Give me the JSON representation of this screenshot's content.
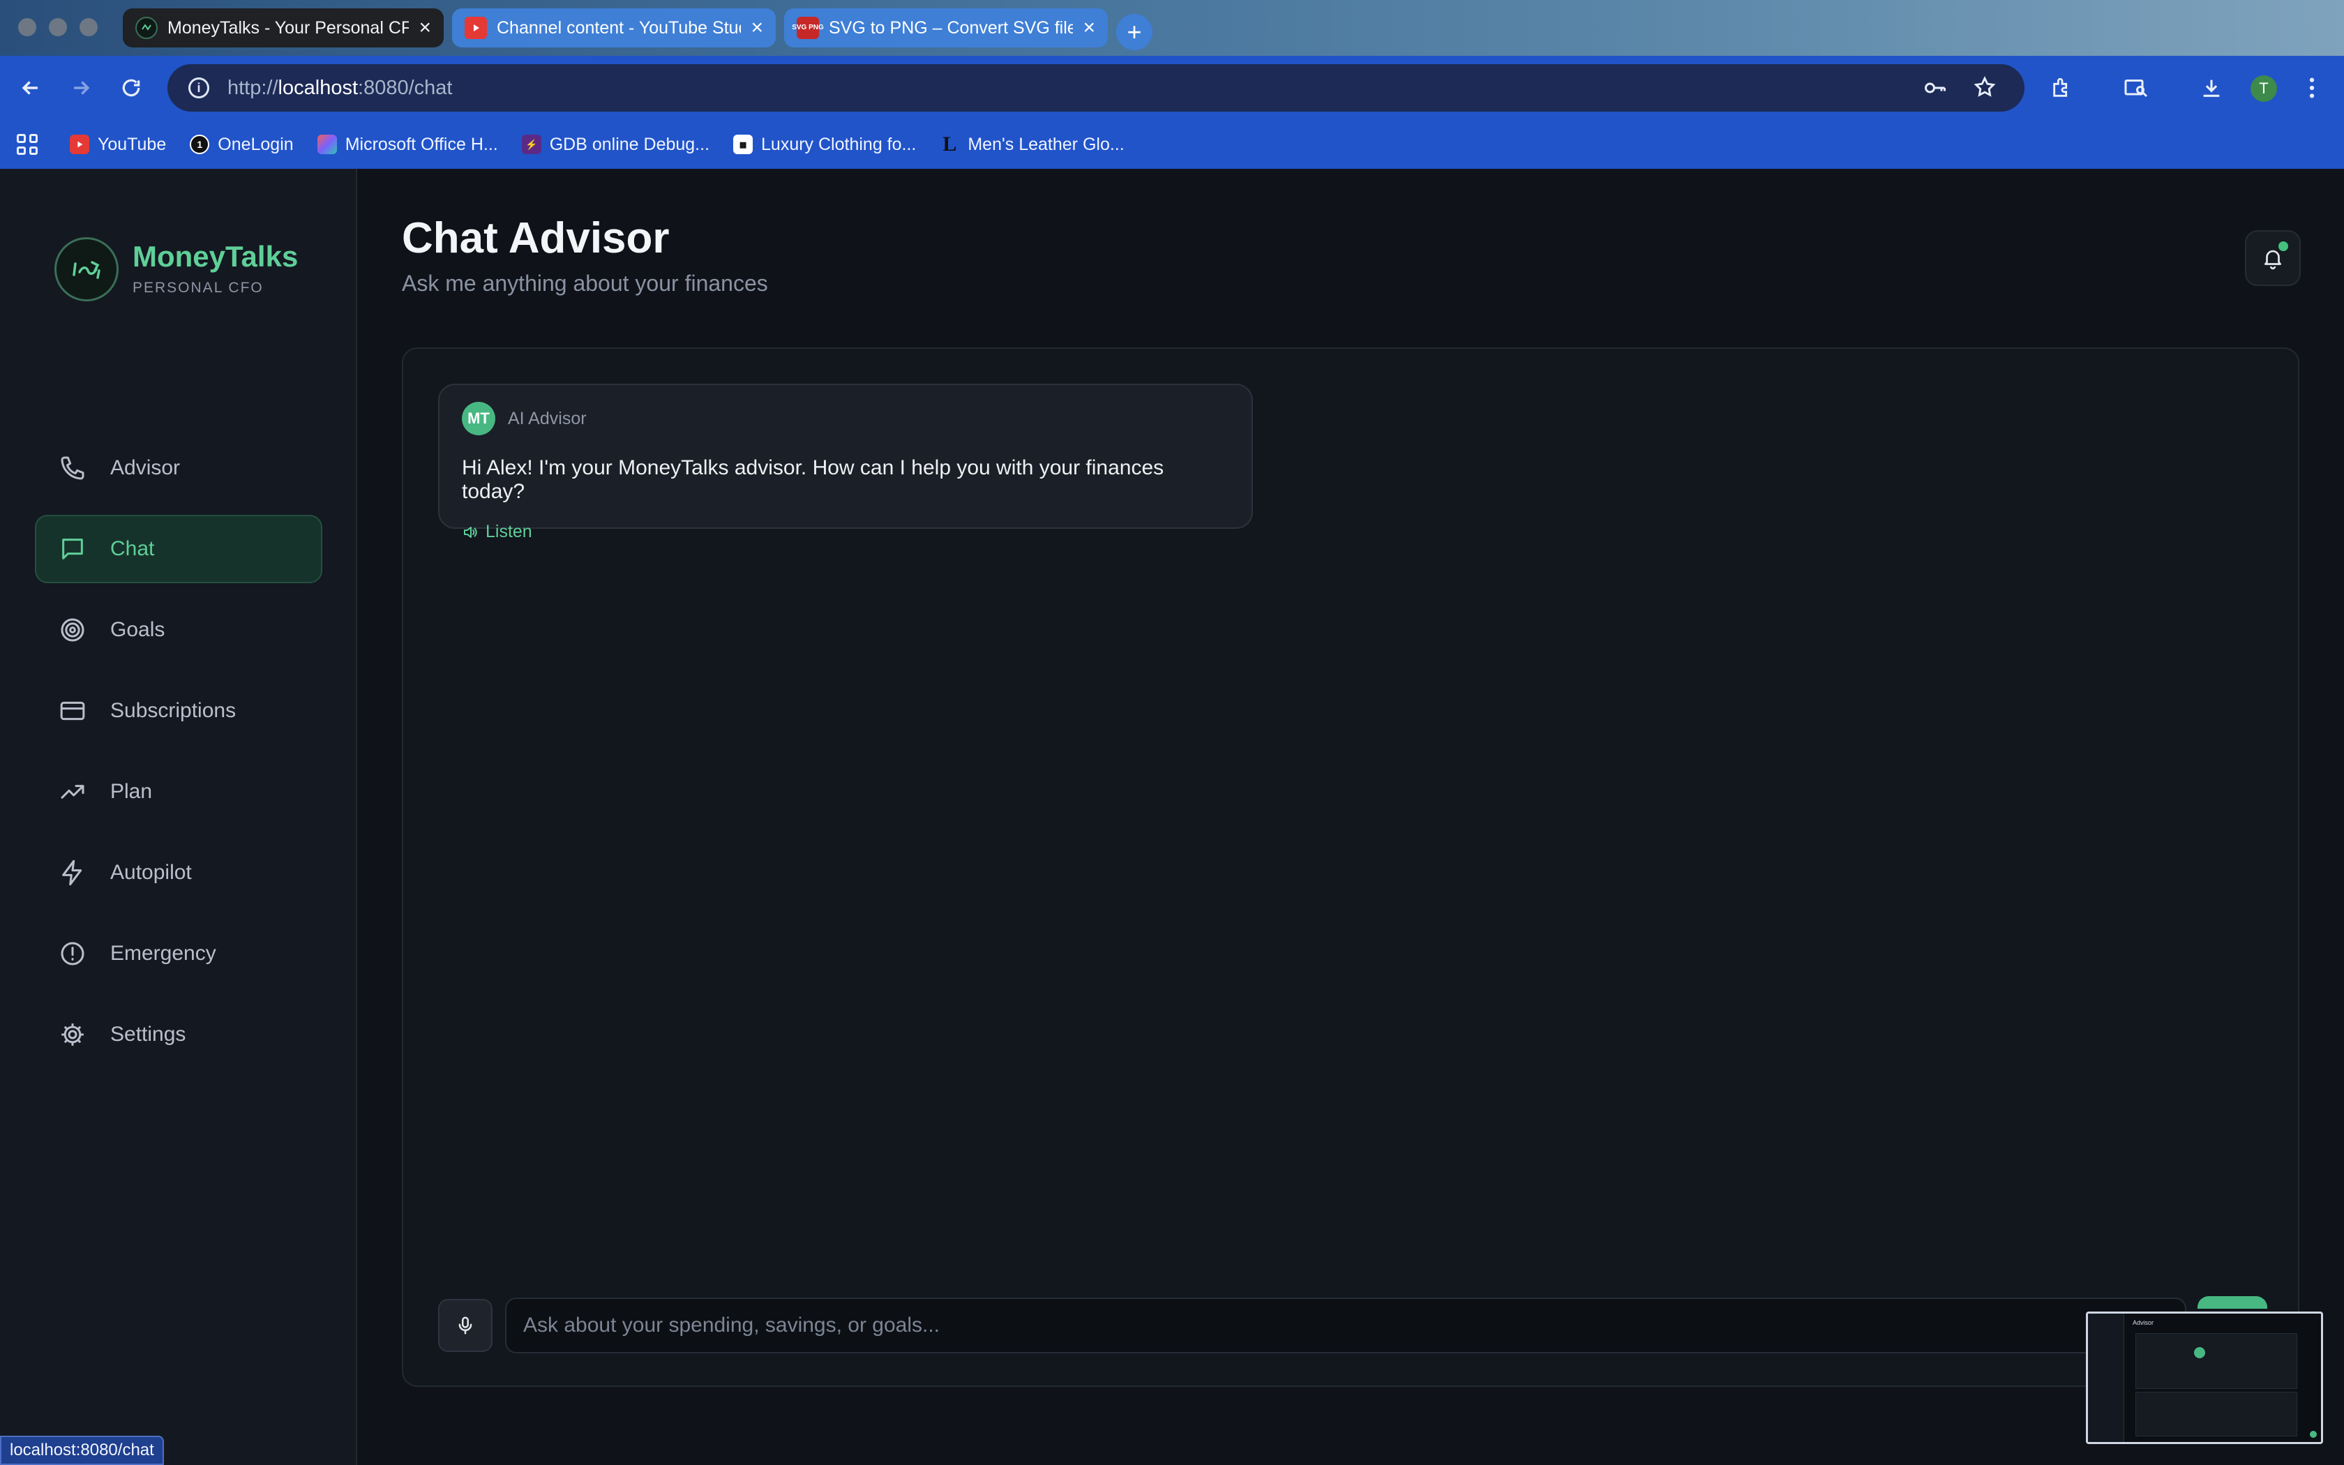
{
  "browser": {
    "tabs": [
      {
        "label": "MoneyTalks - Your Personal CFO",
        "active": true
      },
      {
        "label": "Channel content - YouTube Studio",
        "active": false
      },
      {
        "label": "SVG to PNG – Convert SVG files",
        "active": false
      }
    ],
    "favicon_svg_text": "SVG PNG",
    "url_scheme": "http://",
    "url_host": "localhost",
    "url_path": ":8080/chat",
    "profile_initial": "T",
    "bookmarks": [
      {
        "label": "YouTube",
        "icon": "youtube-icon"
      },
      {
        "label": "OneLogin",
        "icon": "onelogin-icon"
      },
      {
        "label": "Microsoft Office H...",
        "icon": "office-icon"
      },
      {
        "label": "GDB online Debug...",
        "icon": "gdb-icon"
      },
      {
        "label": "Luxury Clothing fo...",
        "icon": "clothing-icon"
      },
      {
        "label": "Men's Leather Glo...",
        "icon": "leather-icon"
      }
    ],
    "status_url": "localhost:8080/chat"
  },
  "sidebar": {
    "brand_name": "MoneyTalks",
    "brand_sub": "PERSONAL CFO",
    "items": [
      {
        "label": "Advisor",
        "icon": "phone-icon",
        "active": false
      },
      {
        "label": "Chat",
        "icon": "chat-bubble-icon",
        "active": true
      },
      {
        "label": "Goals",
        "icon": "target-icon",
        "active": false
      },
      {
        "label": "Subscriptions",
        "icon": "credit-card-icon",
        "active": false
      },
      {
        "label": "Plan",
        "icon": "trending-up-icon",
        "active": false
      },
      {
        "label": "Autopilot",
        "icon": "lightning-icon",
        "active": false
      },
      {
        "label": "Emergency",
        "icon": "alert-circle-icon",
        "active": false
      },
      {
        "label": "Settings",
        "icon": "gear-icon",
        "active": false
      }
    ]
  },
  "main": {
    "title": "Chat Advisor",
    "subtitle": "Ask me anything about your finances",
    "message": {
      "avatar_initials": "MT",
      "sender": "AI Advisor",
      "text": "Hi Alex! I'm your MoneyTalks advisor. How can I help you with your finances today?",
      "listen_label": "Listen"
    },
    "input_placeholder": "Ask about your spending, savings, or goals...",
    "preview_title": "Advisor"
  },
  "colors": {
    "accent": "#5fcf98",
    "accent_bg": "#16332b",
    "background": "#0f1218",
    "browser_toolbar": "#2154c9"
  }
}
